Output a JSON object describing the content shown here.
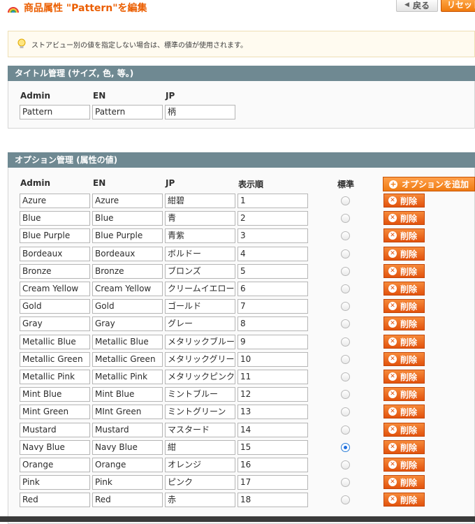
{
  "header": {
    "title": "商品属性 \"Pattern\"を編集",
    "back_label": "戻る",
    "reset_label": "リセット"
  },
  "notice": {
    "text": "ストアビュー別の値を指定しない場合は、標準の値が使用されます。"
  },
  "title_section": {
    "heading": "タイトル管理 (サイズ, 色, 等。)",
    "columns": [
      "Admin",
      "EN",
      "JP"
    ],
    "values": [
      "Pattern",
      "Pattern",
      "柄"
    ]
  },
  "option_section": {
    "heading": "オプション管理 (属性の値)",
    "columns": [
      "Admin",
      "EN",
      "JP",
      "表示順",
      "標準"
    ],
    "add_label": "オプションを追加",
    "delete_label": "削除",
    "rows": [
      {
        "admin": "Azure",
        "en": "Azure",
        "jp": "紺碧",
        "order": "1",
        "default": false
      },
      {
        "admin": "Blue",
        "en": "Blue",
        "jp": "青",
        "order": "2",
        "default": false
      },
      {
        "admin": "Blue Purple",
        "en": "Blue Purple",
        "jp": "青紫",
        "order": "3",
        "default": false
      },
      {
        "admin": "Bordeaux",
        "en": "Bordeaux",
        "jp": "ボルドー",
        "order": "4",
        "default": false
      },
      {
        "admin": "Bronze",
        "en": "Bronze",
        "jp": "ブロンズ",
        "order": "5",
        "default": false
      },
      {
        "admin": "Cream Yellow",
        "en": "Cream Yellow",
        "jp": "クリームイエロー",
        "order": "6",
        "default": false
      },
      {
        "admin": "Gold",
        "en": "Gold",
        "jp": "ゴールド",
        "order": "7",
        "default": false
      },
      {
        "admin": "Gray",
        "en": "Gray",
        "jp": "グレー",
        "order": "8",
        "default": false
      },
      {
        "admin": "Metallic Blue",
        "en": "Metallic Blue",
        "jp": "メタリックブルー",
        "order": "9",
        "default": false
      },
      {
        "admin": "Metallic Green",
        "en": "Metallic Green",
        "jp": "メタリックグリーン",
        "order": "10",
        "default": false
      },
      {
        "admin": "Metallic Pink",
        "en": "Metallic Pink",
        "jp": "メタリックピンク",
        "order": "11",
        "default": false
      },
      {
        "admin": "Mint Blue",
        "en": "Mint Blue",
        "jp": "ミントブルー",
        "order": "12",
        "default": false
      },
      {
        "admin": "Mint Green",
        "en": "MInt Green",
        "jp": "ミントグリーン",
        "order": "13",
        "default": false
      },
      {
        "admin": "Mustard",
        "en": "Mustard",
        "jp": "マスタード",
        "order": "14",
        "default": false
      },
      {
        "admin": "Navy Blue",
        "en": "Navy Blue",
        "jp": "紺",
        "order": "15",
        "default": true
      },
      {
        "admin": "Orange",
        "en": "Orange",
        "jp": "オレンジ",
        "order": "16",
        "default": false
      },
      {
        "admin": "Pink",
        "en": "Pink",
        "jp": "ピンク",
        "order": "17",
        "default": false
      },
      {
        "admin": "Red",
        "en": "Red",
        "jp": "赤",
        "order": "18",
        "default": false
      }
    ]
  },
  "colors": {
    "accent": "#eb5e00",
    "section_header": "#6f8992",
    "delete_button": "#e2520d",
    "notice_bg": "#fffbf0"
  },
  "icons": {
    "logo": "rainbow-logo-icon",
    "notice": "lightbulb-icon",
    "add": "plus-icon",
    "delete": "x-circle-icon",
    "back": "arrow-left-icon"
  }
}
